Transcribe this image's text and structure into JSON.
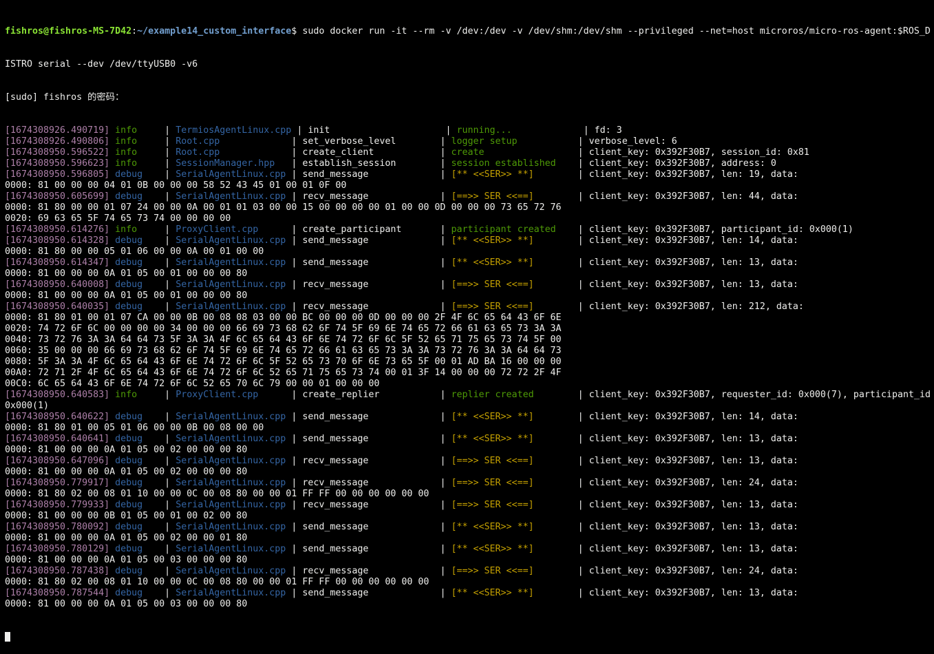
{
  "terminal": {
    "prompt": {
      "user_host": "fishros@fishros-MS-7D42",
      "separator": ":",
      "path": "~/example14_custom_interface",
      "dollar": "$ ",
      "command": "sudo docker run -it --rm -v /dev:/dev -v /dev/shm:/dev/shm --privileged --net=host microros/micro-ros-agent:$ROS_D",
      "command_cont": "ISTRO serial --dev /dev/ttyUSB0 -v6",
      "sudo_prompt": "[sudo] fishros 的密码："
    },
    "lines": [
      {
        "ts": "[1674308926.490719]",
        "level": "info",
        "lpad": "     | ",
        "src": "TermiosAgentLinux.cpp",
        "sep1": " | ",
        "fn": "init                     | ",
        "msg": "running...",
        "spad": "             | ",
        "msgcolor": "green",
        "detail": "fd: 3"
      },
      {
        "ts": "[1674308926.490806]",
        "level": "info",
        "lpad": "     | ",
        "src": "Root.cpp",
        "sep1": "             | ",
        "fn": "set_verbose_level        | ",
        "msg": "logger setup",
        "spad": "           | ",
        "msgcolor": "green",
        "detail": "verbose_level: 6"
      },
      {
        "ts": "[1674308950.596522]",
        "level": "info",
        "lpad": "     | ",
        "src": "Root.cpp",
        "sep1": "             | ",
        "fn": "create_client            | ",
        "msg": "create",
        "spad": "                 | ",
        "msgcolor": "green",
        "detail": "client_key: 0x392F30B7, session_id: 0x81"
      },
      {
        "ts": "[1674308950.596623]",
        "level": "info",
        "lpad": "     | ",
        "src": "SessionManager.hpp",
        "sep1": "   | ",
        "fn": "establish_session        | ",
        "msg": "session established",
        "spad": "    | ",
        "msgcolor": "green",
        "detail": "client_key: 0x392F30B7, address: 0"
      },
      {
        "ts": "[1674308950.596805]",
        "level": "debug",
        "lpad": "    | ",
        "src": "SerialAgentLinux.cpp",
        "sep1": " | ",
        "fn": "send_message             | ",
        "msg": "[** <<SER>> **]",
        "spad": "        | ",
        "msgcolor": "yellow",
        "detail": "client_key: 0x392F30B7, len: 19, data: "
      },
      {
        "raw": "0000: 81 00 00 00 04 01 0B 00 00 00 58 52 43 45 01 00 01 0F 00"
      },
      {
        "ts": "[1674308950.605699]",
        "level": "debug",
        "lpad": "    | ",
        "src": "SerialAgentLinux.cpp",
        "sep1": " | ",
        "fn": "recv_message             | ",
        "msg": "[==>> SER <<==]",
        "spad": "        | ",
        "msgcolor": "yellow",
        "detail": "client_key: 0x392F30B7, len: 44, data: "
      },
      {
        "raw": "0000: 81 80 00 00 01 07 24 00 00 0A 00 01 01 03 00 00 15 00 00 00 00 01 00 00 0D 00 00 00 73 65 72 76"
      },
      {
        "raw": "0020: 69 63 65 5F 74 65 73 74 00 00 00 00"
      },
      {
        "ts": "[1674308950.614276]",
        "level": "info",
        "lpad": "     | ",
        "src": "ProxyClient.cpp",
        "sep1": "      | ",
        "fn": "create_participant       | ",
        "msg": "participant created",
        "spad": "    | ",
        "msgcolor": "green",
        "detail": "client_key: 0x392F30B7, participant_id: 0x000(1)"
      },
      {
        "ts": "[1674308950.614328]",
        "level": "debug",
        "lpad": "    | ",
        "src": "SerialAgentLinux.cpp",
        "sep1": " | ",
        "fn": "send_message             | ",
        "msg": "[** <<SER>> **]",
        "spad": "        | ",
        "msgcolor": "yellow",
        "detail": "client_key: 0x392F30B7, len: 14, data: "
      },
      {
        "raw": "0000: 81 80 00 00 05 01 06 00 00 0A 00 01 00 00"
      },
      {
        "ts": "[1674308950.614347]",
        "level": "debug",
        "lpad": "    | ",
        "src": "SerialAgentLinux.cpp",
        "sep1": " | ",
        "fn": "send_message             | ",
        "msg": "[** <<SER>> **]",
        "spad": "        | ",
        "msgcolor": "yellow",
        "detail": "client_key: 0x392F30B7, len: 13, data: "
      },
      {
        "raw": "0000: 81 00 00 00 0A 01 05 00 01 00 00 00 80"
      },
      {
        "ts": "[1674308950.640008]",
        "level": "debug",
        "lpad": "    | ",
        "src": "SerialAgentLinux.cpp",
        "sep1": " | ",
        "fn": "recv_message             | ",
        "msg": "[==>> SER <<==]",
        "spad": "        | ",
        "msgcolor": "yellow",
        "detail": "client_key: 0x392F30B7, len: 13, data: "
      },
      {
        "raw": "0000: 81 00 00 00 0A 01 05 00 01 00 00 00 80"
      },
      {
        "ts": "[1674308950.640035]",
        "level": "debug",
        "lpad": "    | ",
        "src": "SerialAgentLinux.cpp",
        "sep1": " | ",
        "fn": "recv_message             | ",
        "msg": "[==>> SER <<==]",
        "spad": "        | ",
        "msgcolor": "yellow",
        "detail": "client_key: 0x392F30B7, len: 212, data: "
      },
      {
        "raw": "0000: 81 80 01 00 01 07 CA 00 00 0B 00 08 08 03 00 00 BC 00 00 00 0D 00 00 00 2F 4F 6C 65 64 43 6F 6E"
      },
      {
        "raw": "0020: 74 72 6F 6C 00 00 00 00 34 00 00 00 66 69 73 68 62 6F 74 5F 69 6E 74 65 72 66 61 63 65 73 3A 3A"
      },
      {
        "raw": "0040: 73 72 76 3A 3A 64 64 73 5F 3A 3A 4F 6C 65 64 43 6F 6E 74 72 6F 6C 5F 52 65 71 75 65 73 74 5F 00"
      },
      {
        "raw": "0060: 35 00 00 00 66 69 73 68 62 6F 74 5F 69 6E 74 65 72 66 61 63 65 73 3A 3A 73 72 76 3A 3A 64 64 73"
      },
      {
        "raw": "0080: 5F 3A 3A 4F 6C 65 64 43 6F 6E 74 72 6F 6C 5F 52 65 73 70 6F 6E 73 65 5F 00 01 AD BA 16 00 00 00"
      },
      {
        "raw": "00A0: 72 71 2F 4F 6C 65 64 43 6F 6E 74 72 6F 6C 52 65 71 75 65 73 74 00 01 3F 14 00 00 00 72 72 2F 4F"
      },
      {
        "raw": "00C0: 6C 65 64 43 6F 6E 74 72 6F 6C 52 65 70 6C 79 00 00 01 00 00 00"
      },
      {
        "ts": "[1674308950.640583]",
        "level": "info",
        "lpad": "     | ",
        "src": "ProxyClient.cpp",
        "sep1": "      | ",
        "fn": "create_replier           | ",
        "msg": "replier created",
        "spad": "        | ",
        "msgcolor": "green",
        "detail": "client_key: 0x392F30B7, requester_id: 0x000(7), participant_id:"
      },
      {
        "raw": "0x000(1)"
      },
      {
        "ts": "[1674308950.640622]",
        "level": "debug",
        "lpad": "    | ",
        "src": "SerialAgentLinux.cpp",
        "sep1": " | ",
        "fn": "send_message             | ",
        "msg": "[** <<SER>> **]",
        "spad": "        | ",
        "msgcolor": "yellow",
        "detail": "client_key: 0x392F30B7, len: 14, data: "
      },
      {
        "raw": "0000: 81 80 01 00 05 01 06 00 00 0B 00 08 00 00"
      },
      {
        "ts": "[1674308950.640641]",
        "level": "debug",
        "lpad": "    | ",
        "src": "SerialAgentLinux.cpp",
        "sep1": " | ",
        "fn": "send_message             | ",
        "msg": "[** <<SER>> **]",
        "spad": "        | ",
        "msgcolor": "yellow",
        "detail": "client_key: 0x392F30B7, len: 13, data: "
      },
      {
        "raw": "0000: 81 00 00 00 0A 01 05 00 02 00 00 00 80"
      },
      {
        "ts": "[1674308950.647096]",
        "level": "debug",
        "lpad": "    | ",
        "src": "SerialAgentLinux.cpp",
        "sep1": " | ",
        "fn": "recv_message             | ",
        "msg": "[==>> SER <<==]",
        "spad": "        | ",
        "msgcolor": "yellow",
        "detail": "client_key: 0x392F30B7, len: 13, data: "
      },
      {
        "raw": "0000: 81 00 00 00 0A 01 05 00 02 00 00 00 80"
      },
      {
        "ts": "[1674308950.779917]",
        "level": "debug",
        "lpad": "    | ",
        "src": "SerialAgentLinux.cpp",
        "sep1": " | ",
        "fn": "recv_message             | ",
        "msg": "[==>> SER <<==]",
        "spad": "        | ",
        "msgcolor": "yellow",
        "detail": "client_key: 0x392F30B7, len: 24, data: "
      },
      {
        "raw": "0000: 81 80 02 00 08 01 10 00 00 0C 00 08 80 00 00 01 FF FF 00 00 00 00 00 00"
      },
      {
        "ts": "[1674308950.779933]",
        "level": "debug",
        "lpad": "    | ",
        "src": "SerialAgentLinux.cpp",
        "sep1": " | ",
        "fn": "recv_message             | ",
        "msg": "[==>> SER <<==]",
        "spad": "        | ",
        "msgcolor": "yellow",
        "detail": "client_key: 0x392F30B7, len: 13, data: "
      },
      {
        "raw": "0000: 81 00 00 00 0B 01 05 00 01 00 02 00 80"
      },
      {
        "ts": "[1674308950.780092]",
        "level": "debug",
        "lpad": "    | ",
        "src": "SerialAgentLinux.cpp",
        "sep1": " | ",
        "fn": "send_message             | ",
        "msg": "[** <<SER>> **]",
        "spad": "        | ",
        "msgcolor": "yellow",
        "detail": "client_key: 0x392F30B7, len: 13, data: "
      },
      {
        "raw": "0000: 81 00 00 00 0A 01 05 00 02 00 00 01 80"
      },
      {
        "ts": "[1674308950.780129]",
        "level": "debug",
        "lpad": "    | ",
        "src": "SerialAgentLinux.cpp",
        "sep1": " | ",
        "fn": "send_message             | ",
        "msg": "[** <<SER>> **]",
        "spad": "        | ",
        "msgcolor": "yellow",
        "detail": "client_key: 0x392F30B7, len: 13, data: "
      },
      {
        "raw": "0000: 81 00 00 00 0A 01 05 00 03 00 00 00 80"
      },
      {
        "ts": "[1674308950.787438]",
        "level": "debug",
        "lpad": "    | ",
        "src": "SerialAgentLinux.cpp",
        "sep1": " | ",
        "fn": "recv_message             | ",
        "msg": "[==>> SER <<==]",
        "spad": "        | ",
        "msgcolor": "yellow",
        "detail": "client_key: 0x392F30B7, len: 24, data: "
      },
      {
        "raw": "0000: 81 80 02 00 08 01 10 00 00 0C 00 08 80 00 00 01 FF FF 00 00 00 00 00 00"
      },
      {
        "ts": "[1674308950.787544]",
        "level": "debug",
        "lpad": "    | ",
        "src": "SerialAgentLinux.cpp",
        "sep1": " | ",
        "fn": "send_message             | ",
        "msg": "[** <<SER>> **]",
        "spad": "        | ",
        "msgcolor": "yellow",
        "detail": "client_key: 0x392F30B7, len: 13, data: "
      },
      {
        "raw": "0000: 81 00 00 00 0A 01 05 00 03 00 00 00 80"
      }
    ]
  }
}
